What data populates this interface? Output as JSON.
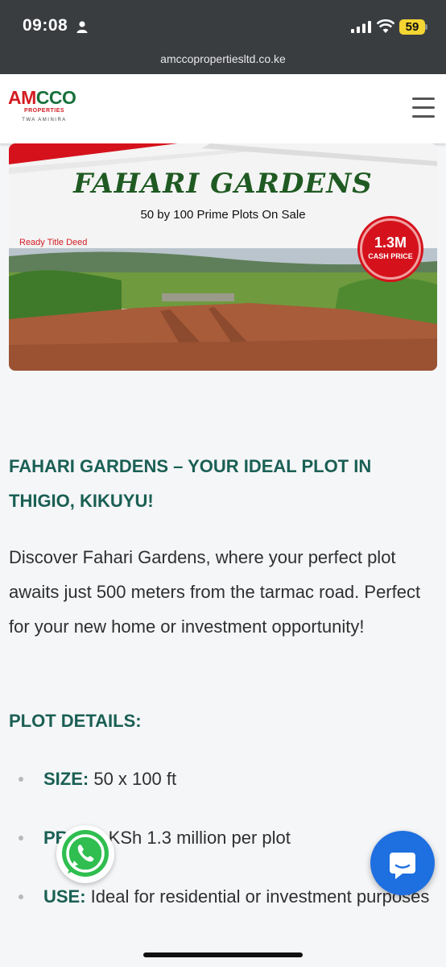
{
  "status_bar": {
    "time": "09:08",
    "battery": "59",
    "url": "amccopropertiesltd.co.ke"
  },
  "site": {
    "logo_part1": "AM",
    "logo_part2": "CCO",
    "logo_sub": "PROPERTIES",
    "logo_tag": "TWA AMINIRA"
  },
  "hero": {
    "title": "FAHARI GARDENS",
    "subtitle": "50 by 100 Prime Plots On Sale",
    "deed": "Ready Title Deed",
    "badge_amount": "1.3M",
    "badge_label": "CASH PRICE"
  },
  "article": {
    "heading": "FAHARI GARDENS – YOUR IDEAL PLOT IN THIGIO, KIKUYU!",
    "paragraph": "Discover Fahari Gardens, where your perfect plot awaits just 500 meters from the tarmac road. Perfect for your new home or investment opportunity!",
    "details_heading": "PLOT DETAILS:",
    "details": [
      {
        "label": "SIZE:",
        "value": " 50 x 100 ft"
      },
      {
        "label": "PRICE:",
        "value": " KSh 1.3 million per plot"
      },
      {
        "label": "USE:",
        "value": " Ideal for residential or investment purposes"
      }
    ]
  },
  "icons": [
    "person-icon",
    "signal-icon",
    "wifi-icon",
    "menu-icon",
    "whatsapp-icon",
    "chat-icon"
  ],
  "colors": {
    "heading": "#1a5f54",
    "brand_red": "#d31b22",
    "brand_green": "#17703a",
    "chat_button": "#1e6fe0"
  }
}
